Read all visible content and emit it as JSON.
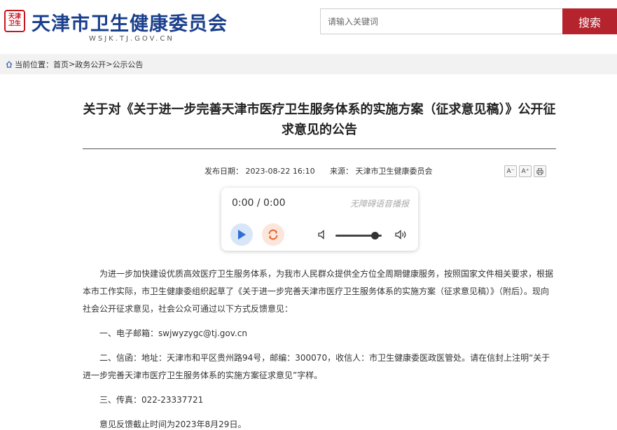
{
  "header": {
    "logo_text": "天津卫生",
    "site_title": "天津市卫生健康委员会",
    "site_domain": "WSJK.TJ.GOV.CN",
    "search_placeholder": "请输入关键词",
    "search_button": "搜索",
    "accent_color": "#b5232d",
    "title_color": "#1a3f8c"
  },
  "breadcrumb": {
    "label": "当前位置：",
    "items": [
      "首页",
      "政务公开",
      "公示公告"
    ],
    "separator": ">"
  },
  "article": {
    "title": "关于对《关于进一步完善天津市医疗卫生服务体系的实施方案（征求意见稿）》公开征求意见的公告",
    "date_label": "发布日期：",
    "date": "2023-08-22 16:10",
    "source_label": "来源：",
    "source": "天津市卫生健康委员会",
    "tools": {
      "font_smaller": "A⁻",
      "font_larger": "A⁺",
      "print_icon": "print-icon"
    },
    "paragraphs": [
      "为进一步加快建设优质高效医疗卫生服务体系，为我市人民群众提供全方位全周期健康服务，按照国家文件相关要求，根据本市工作实际，市卫生健康委组织起草了《关于进一步完善天津市医疗卫生服务体系的实施方案（征求意见稿）》（附后）。现向社会公开征求意见，社会公众可通过以下方式反馈意见：",
      "一、电子邮箱：swjwyzygc@tj.gov.cn",
      "二、信函：地址：天津市和平区贵州路94号，邮编：300070，收信人：市卫生健康委医政医管处。请在信封上注明“关于进一步完善天津市医疗卫生服务体系的实施方案征求意见”字样。",
      "三、传真：022-23337721",
      "意见反馈截止时间为2023年8月29日。"
    ]
  },
  "audio_player": {
    "time": "0:00 / 0:00",
    "caption": "无障碍语音播报",
    "volume_level": 0.85,
    "play_color": "#2f6fd6",
    "loop_color": "#e8622c"
  }
}
